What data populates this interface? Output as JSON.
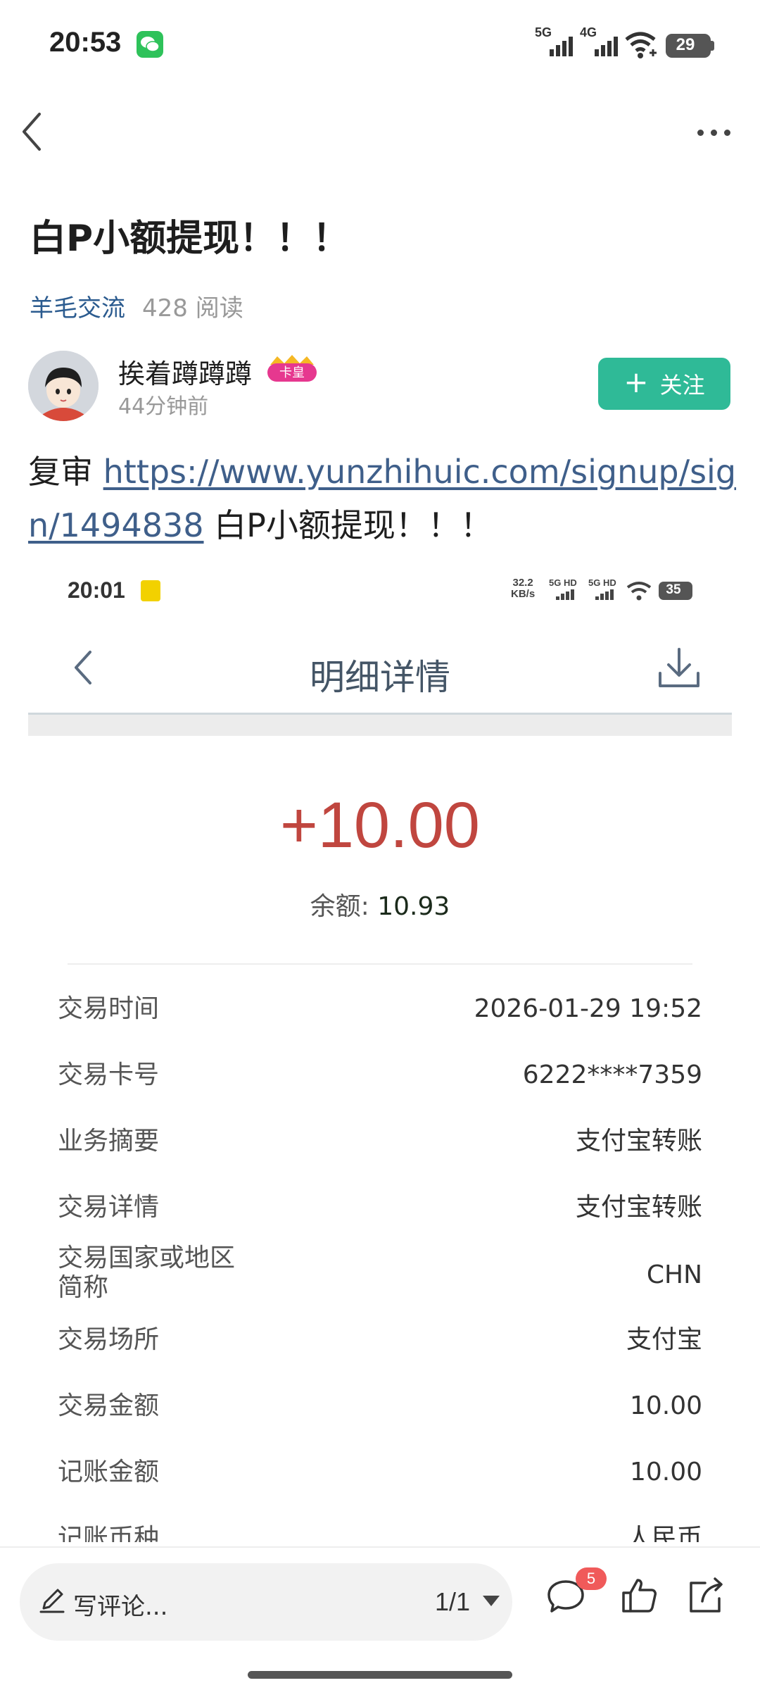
{
  "status_bar": {
    "time": "20:53",
    "network1": "5G",
    "network2": "4G",
    "battery": "29"
  },
  "post": {
    "title": "白P小额提现！！！",
    "topic": "羊毛交流",
    "reads": "428 阅读",
    "author": "挨着蹲蹲蹲",
    "author_badge": "卡皇",
    "time_ago": "44分钟前",
    "follow_label": "关注",
    "body_prefix": "复审 ",
    "body_link": "https://www.yunzhihuic.com/signup/sign/1494838",
    "body_suffix": " 白P小额提现！！！"
  },
  "screenshot": {
    "time": "20:01",
    "speed": "32.2",
    "speed_unit": "KB/s",
    "net_a": "5G HD",
    "net_b": "5G HD",
    "battery": "35",
    "title": "明细详情",
    "amount": "+10.00",
    "balance_label": "余额: ",
    "balance_value": "10.93",
    "rows": [
      {
        "label": "交易时间",
        "value": "2026-01-29 19:52"
      },
      {
        "label": "交易卡号",
        "value": "6222****7359"
      },
      {
        "label": "业务摘要",
        "value": "支付宝转账"
      },
      {
        "label": "交易详情",
        "value": "支付宝转账"
      },
      {
        "label": "交易国家或地区\n简称",
        "value": "CHN"
      },
      {
        "label": "交易场所",
        "value": "支付宝"
      },
      {
        "label": "交易金额",
        "value": "10.00"
      },
      {
        "label": "记账金额",
        "value": "10.00"
      },
      {
        "label": "记账币种",
        "value": "人民币"
      }
    ]
  },
  "bottom_bar": {
    "comment_placeholder": "写评论...",
    "page_indicator": "1/1",
    "comment_count": "5"
  },
  "colors": {
    "accent_green": "#2fba97",
    "topic_blue": "#2b5b8f",
    "amount_red": "#c0463f",
    "badge_red": "#f05a5a"
  },
  "icons": [
    "wechat-icon",
    "signal-icon",
    "wifi-icon",
    "battery-icon",
    "back-arrow-icon",
    "more-icon",
    "crown-icon",
    "download-icon",
    "pen-icon",
    "comment-icon",
    "like-icon",
    "share-icon"
  ]
}
